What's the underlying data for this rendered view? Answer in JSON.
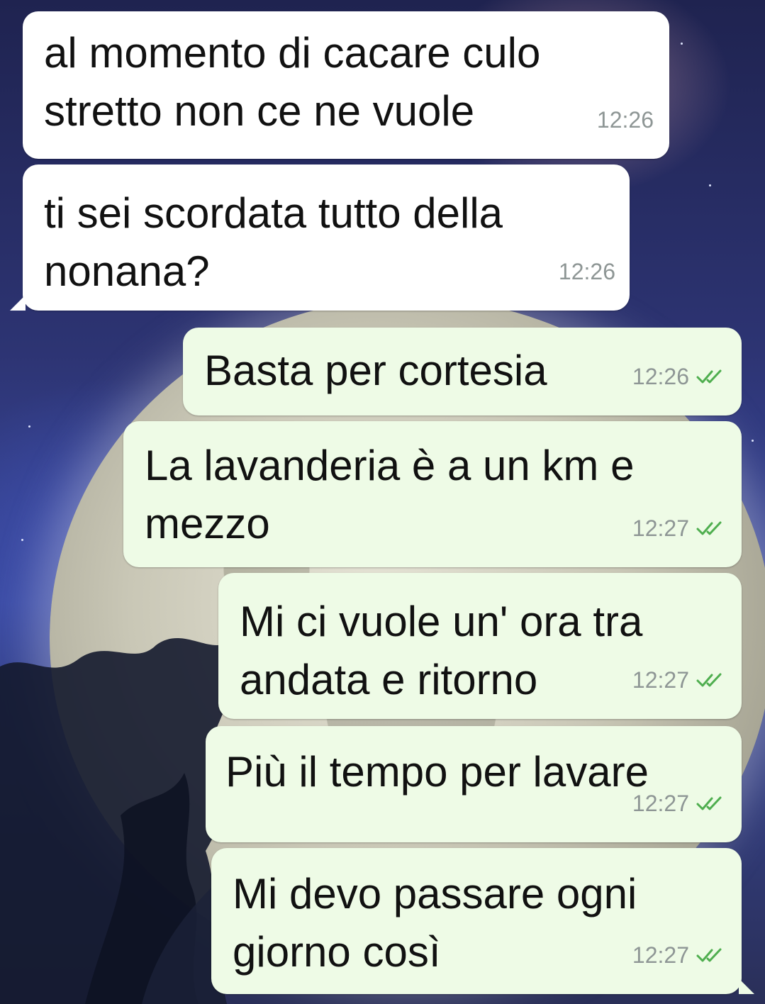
{
  "messages": [
    {
      "direction": "incoming",
      "text": "al momento di cacare culo\nstretto non ce ne vuole",
      "time": "12:26"
    },
    {
      "direction": "incoming",
      "text": "ti sei scordata tutto della\nnonana?",
      "time": "12:26"
    },
    {
      "direction": "outgoing",
      "text": "Basta per cortesia",
      "time": "12:26",
      "status": "read"
    },
    {
      "direction": "outgoing",
      "text": "La lavanderia è a un km e\nmezzo",
      "time": "12:27",
      "status": "read"
    },
    {
      "direction": "outgoing",
      "text": "Mi ci vuole un' ora tra\nandata e ritorno",
      "time": "12:27",
      "status": "read"
    },
    {
      "direction": "outgoing",
      "text": "Più il tempo per lavare",
      "time": "12:27",
      "status": "read"
    },
    {
      "direction": "outgoing",
      "text": "Mi devo passare ogni\ngiorno così",
      "time": "12:27",
      "status": "read"
    }
  ],
  "colors": {
    "incoming_bubble": "#ffffff",
    "outgoing_bubble": "#eefbe6",
    "timestamp": "#8e9695",
    "read_ticks": "#4fae4f"
  },
  "icons": {
    "read_receipt": "double-check-icon"
  },
  "wallpaper": "night-sky-full-moon-trees"
}
